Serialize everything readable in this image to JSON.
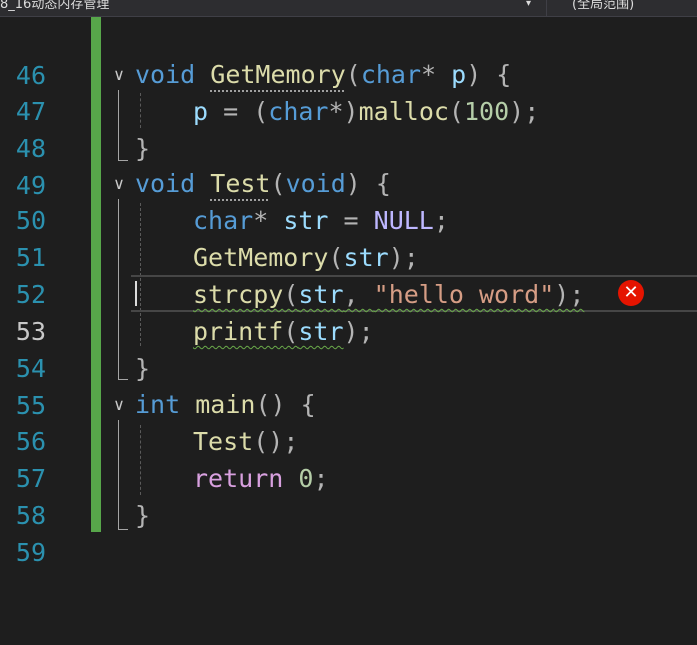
{
  "toolbar": {
    "scope_left": "8_16动态内存管理",
    "scope_left_arrow": "▾",
    "scope_right": "(全局范围)"
  },
  "editor": {
    "current_line": 53,
    "lines": [
      {
        "num": "46"
      },
      {
        "num": "47",
        "tokens": [
          [
            "kw",
            "void"
          ],
          [
            "t",
            " "
          ],
          [
            "fn",
            "GetMemory"
          ],
          [
            "pn",
            "("
          ],
          [
            "kw",
            "char"
          ],
          [
            "pn",
            "* "
          ],
          [
            "pl",
            "p"
          ],
          [
            "pn",
            ") {"
          ]
        ]
      },
      {
        "num": "48",
        "tokens": [
          [
            "pl",
            "p"
          ],
          [
            "pn",
            " = ("
          ],
          [
            "kw",
            "char"
          ],
          [
            "pn",
            "*)"
          ],
          [
            "fn",
            "malloc"
          ],
          [
            "pn",
            "("
          ],
          [
            "num",
            "100"
          ],
          [
            "pn",
            ");"
          ]
        ]
      },
      {
        "num": "49",
        "tokens": []
      },
      {
        "num": "50",
        "tokens": [
          [
            "kw",
            "void"
          ],
          [
            "t",
            " "
          ],
          [
            "fn",
            "Test"
          ],
          [
            "pn",
            "("
          ],
          [
            "kw",
            "void"
          ],
          [
            "pn",
            ") {"
          ]
        ]
      },
      {
        "num": "51",
        "tokens": [
          [
            "kw",
            "char"
          ],
          [
            "pn",
            "* "
          ],
          [
            "var",
            "str"
          ],
          [
            "pn",
            " = "
          ],
          [
            "mac",
            "NULL"
          ],
          [
            "pn",
            ";"
          ]
        ]
      },
      {
        "num": "52",
        "tokens": [
          [
            "fn",
            "GetMemory"
          ],
          [
            "pn",
            "("
          ],
          [
            "var",
            "str"
          ],
          [
            "pn",
            ");"
          ]
        ]
      },
      {
        "num": "53",
        "tokens": [
          [
            "fn",
            "strcpy"
          ],
          [
            "pn",
            "("
          ],
          [
            "var",
            "str"
          ],
          [
            "pn",
            ", "
          ],
          [
            "str",
            "\"hello word\""
          ],
          [
            "pn",
            ");"
          ]
        ]
      },
      {
        "num": "54",
        "tokens": [
          [
            "fn",
            "printf"
          ],
          [
            "pn",
            "("
          ],
          [
            "var",
            "str"
          ],
          [
            "pn",
            ");"
          ]
        ]
      },
      {
        "num": "55",
        "tokens": []
      },
      {
        "num": "56",
        "tokens": [
          [
            "kw",
            "int"
          ],
          [
            "t",
            " "
          ],
          [
            "fn",
            "main"
          ],
          [
            "pn",
            "() {"
          ]
        ]
      },
      {
        "num": "57",
        "tokens": [
          [
            "fn",
            "Test"
          ],
          [
            "pn",
            "();"
          ]
        ]
      },
      {
        "num": "58",
        "tokens": [
          [
            "ctl",
            "return"
          ],
          [
            "t",
            " "
          ],
          [
            "num",
            "0"
          ],
          [
            "pn",
            ";"
          ]
        ]
      },
      {
        "num": "59",
        "tokens": []
      }
    ],
    "text": {
      "l47": {
        "void": "void",
        "fn": "GetMemory",
        "open": "(",
        "char": "char",
        "star": "* ",
        "p": "p",
        "close": ") {"
      },
      "l48": {
        "p": "p",
        "eq": " = (",
        "char": "char",
        "cast": "*)",
        "fn": "malloc",
        "open": "(",
        "num": "100",
        "close": ");"
      },
      "l49": {
        "brace": "}"
      },
      "l50": {
        "void": "void",
        "fn": "Test",
        "open": "(",
        "void2": "void",
        "close": ") {"
      },
      "l51": {
        "char": "char",
        "star": "* ",
        "str": "str",
        "eq": " = ",
        "null": "NULL",
        "semi": ";"
      },
      "l52": {
        "fn": "GetMemory",
        "open": "(",
        "str": "str",
        "close": ");"
      },
      "l53": {
        "fn": "strcpy",
        "open": "(",
        "str": "str",
        "comma": ", ",
        "lit": "\"hello word\"",
        "close": ");"
      },
      "l54": {
        "fn": "printf",
        "open": "(",
        "str": "str",
        "close": ");"
      },
      "l55": {
        "brace": "}"
      },
      "l56": {
        "int": "int",
        "fn": "main",
        "close": "() {"
      },
      "l57": {
        "fn": "Test",
        "close": "();"
      },
      "l58": {
        "ret": "return",
        "num": "0",
        "semi": ";"
      },
      "l59": {
        "brace": "}"
      }
    },
    "fold_glyph": "∨",
    "error_glyph": "✕"
  },
  "colors": {
    "background": "#1e1e1e",
    "line_number": "#2b91af",
    "keyword": "#569cd6",
    "control_keyword": "#d8a0df",
    "function": "#dcdcaa",
    "variable": "#9cdcfe",
    "number": "#b5cea8",
    "string": "#d69d85",
    "macro": "#beb7ff",
    "change_bar": "#57a64a",
    "error": "#e51400",
    "warning_squiggle": "#6aaa4a"
  }
}
